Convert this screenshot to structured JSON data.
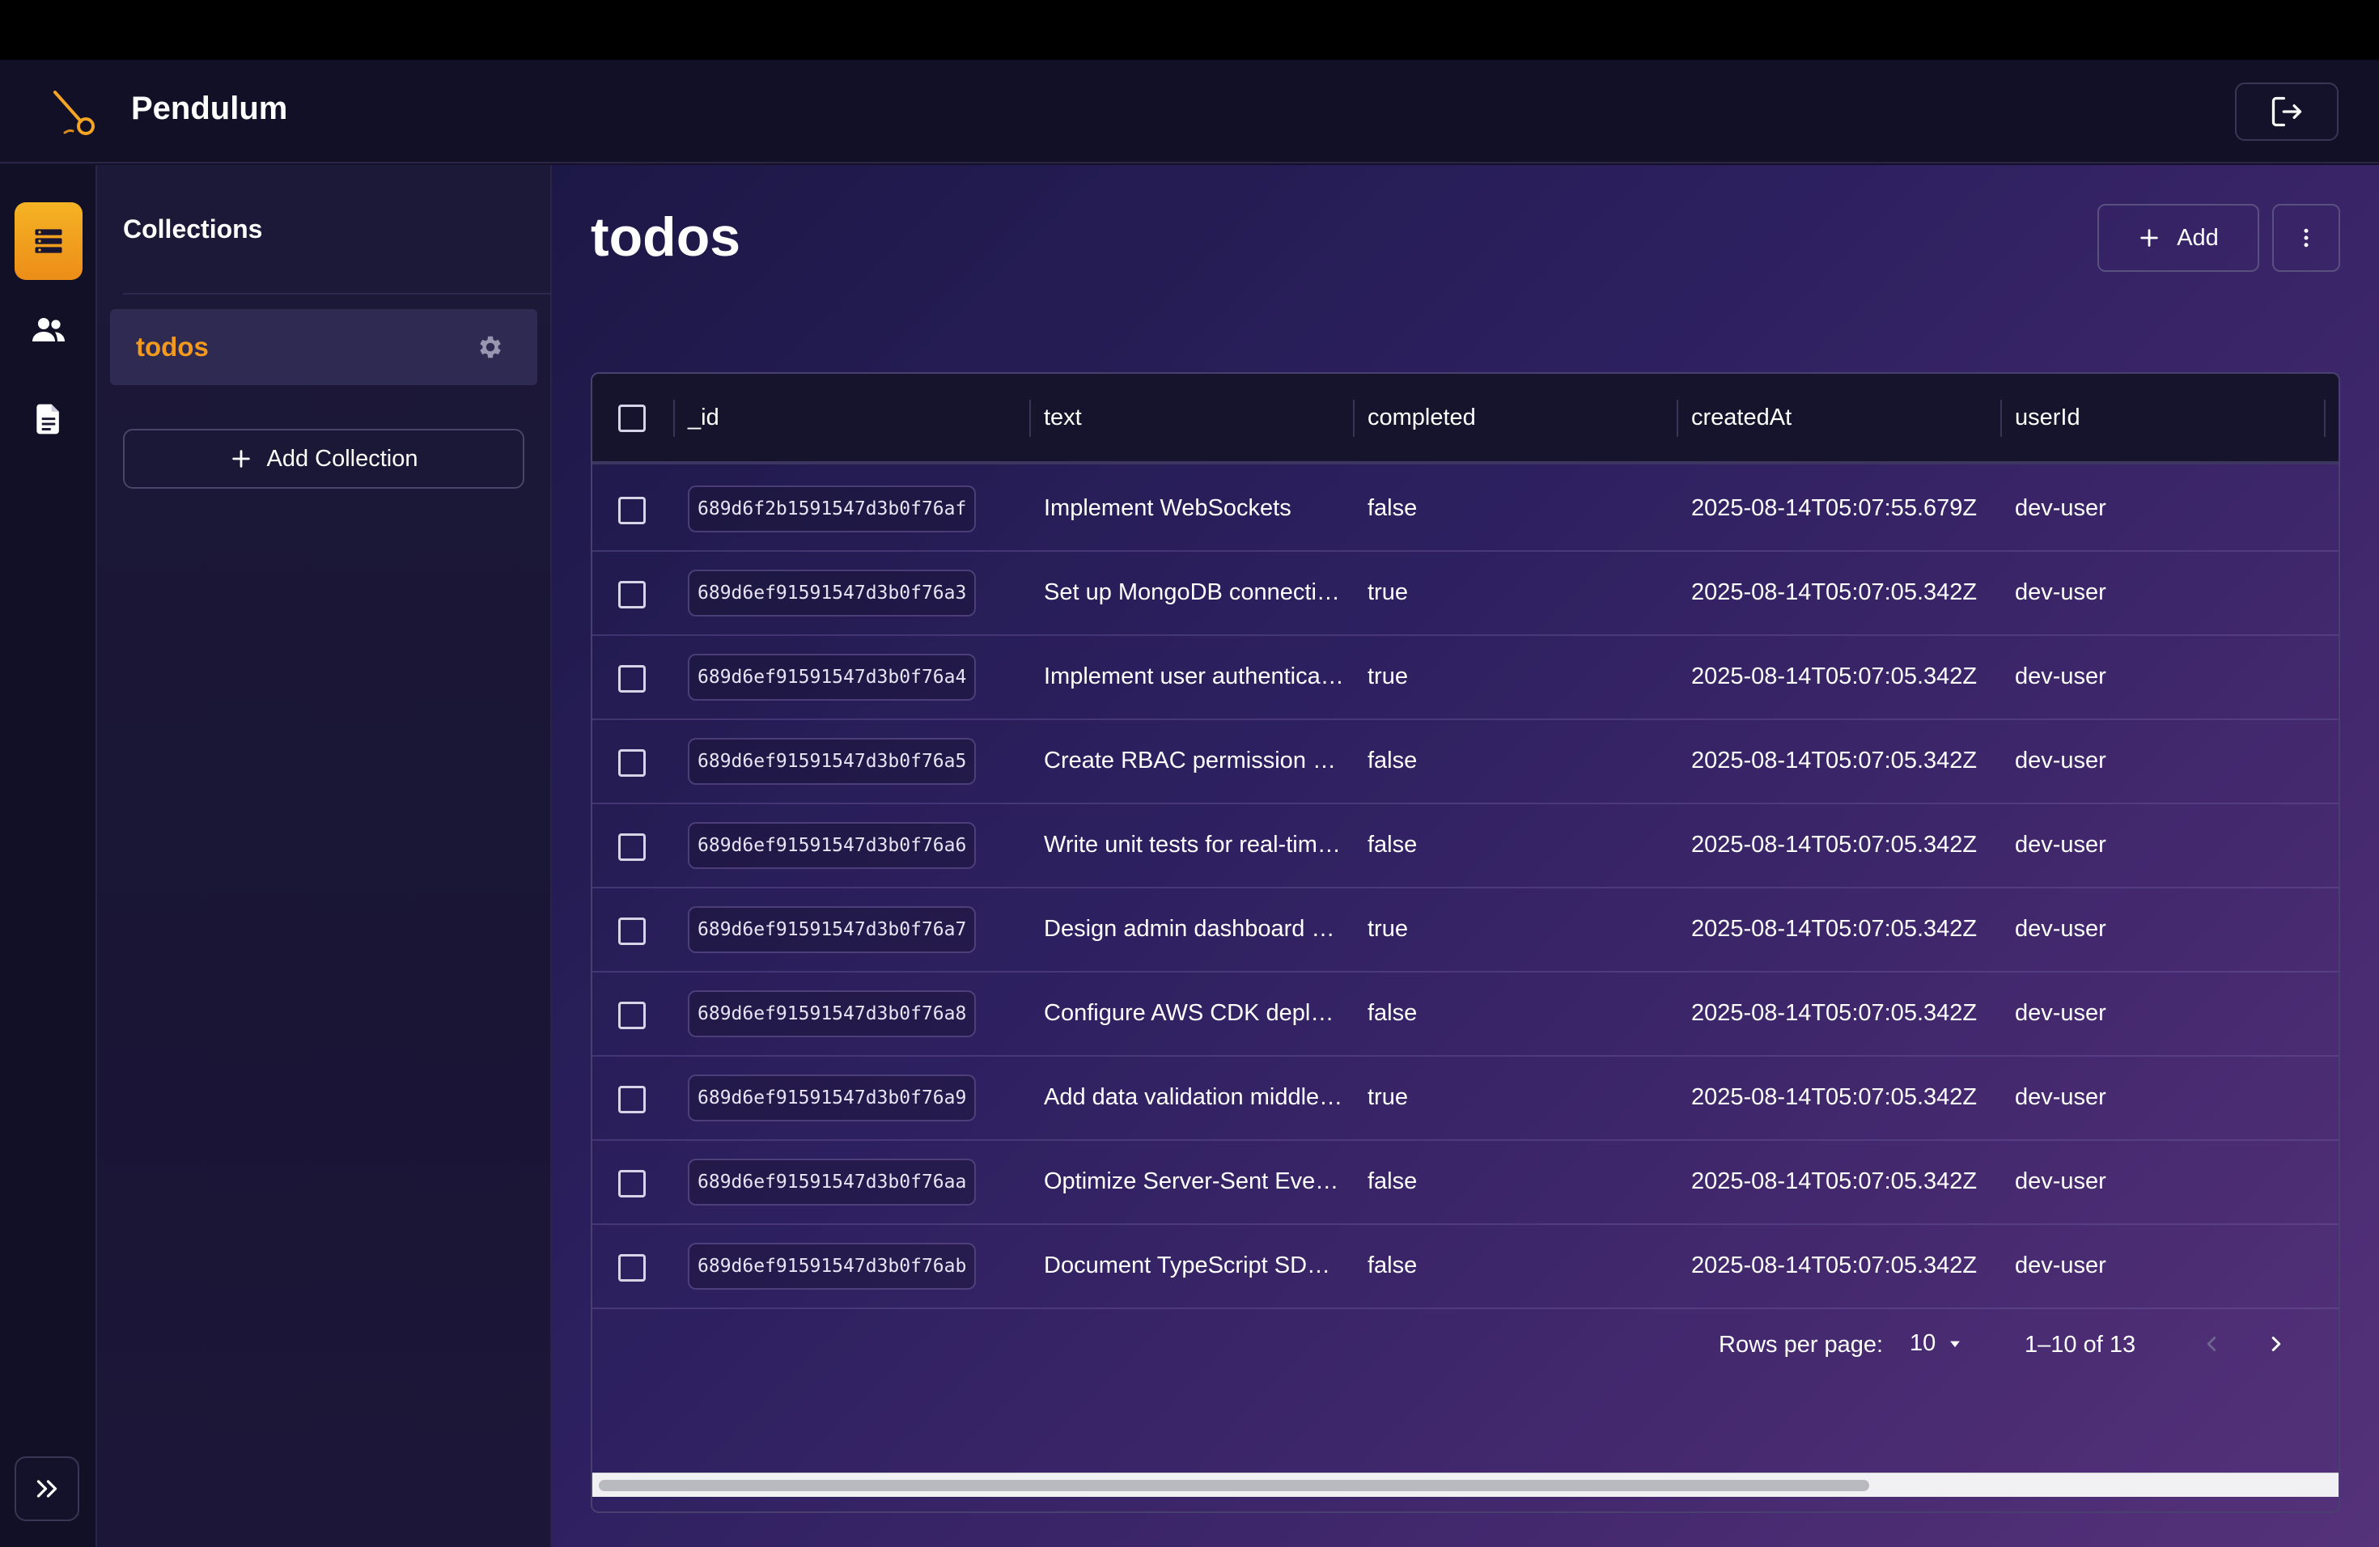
{
  "app": {
    "brand": "Pendulum"
  },
  "sidebar": {
    "title": "Collections",
    "collections": [
      {
        "label": "todos"
      }
    ],
    "add_collection_label": "Add Collection",
    "rail_icons": [
      "collections-icon",
      "users-icon",
      "document-icon"
    ]
  },
  "main": {
    "title": "todos",
    "add_label": "Add"
  },
  "table": {
    "columns": [
      "_id",
      "text",
      "completed",
      "createdAt",
      "userId"
    ],
    "rows": [
      {
        "id": "689d6f2b1591547d3b0f76af",
        "text": "Implement WebSockets",
        "completed": "false",
        "createdAt": "2025-08-14T05:07:55.679Z",
        "userId": "dev-user"
      },
      {
        "id": "689d6ef91591547d3b0f76a3",
        "text": "Set up MongoDB connecti…",
        "completed": "true",
        "createdAt": "2025-08-14T05:07:05.342Z",
        "userId": "dev-user"
      },
      {
        "id": "689d6ef91591547d3b0f76a4",
        "text": "Implement user authentica…",
        "completed": "true",
        "createdAt": "2025-08-14T05:07:05.342Z",
        "userId": "dev-user"
      },
      {
        "id": "689d6ef91591547d3b0f76a5",
        "text": "Create RBAC permission …",
        "completed": "false",
        "createdAt": "2025-08-14T05:07:05.342Z",
        "userId": "dev-user"
      },
      {
        "id": "689d6ef91591547d3b0f76a6",
        "text": "Write unit tests for real-tim…",
        "completed": "false",
        "createdAt": "2025-08-14T05:07:05.342Z",
        "userId": "dev-user"
      },
      {
        "id": "689d6ef91591547d3b0f76a7",
        "text": "Design admin dashboard …",
        "completed": "true",
        "createdAt": "2025-08-14T05:07:05.342Z",
        "userId": "dev-user"
      },
      {
        "id": "689d6ef91591547d3b0f76a8",
        "text": "Configure AWS CDK depl…",
        "completed": "false",
        "createdAt": "2025-08-14T05:07:05.342Z",
        "userId": "dev-user"
      },
      {
        "id": "689d6ef91591547d3b0f76a9",
        "text": "Add data validation middle…",
        "completed": "true",
        "createdAt": "2025-08-14T05:07:05.342Z",
        "userId": "dev-user"
      },
      {
        "id": "689d6ef91591547d3b0f76aa",
        "text": "Optimize Server-Sent Eve…",
        "completed": "false",
        "createdAt": "2025-08-14T05:07:05.342Z",
        "userId": "dev-user"
      },
      {
        "id": "689d6ef91591547d3b0f76ab",
        "text": "Document TypeScript SD…",
        "completed": "false",
        "createdAt": "2025-08-14T05:07:05.342Z",
        "userId": "dev-user"
      }
    ]
  },
  "pagination": {
    "rows_per_page_label": "Rows per page:",
    "rows_per_page_value": "10",
    "range_text": "1–10 of 13"
  },
  "colors": {
    "accent": "#f29a1e",
    "rail_active_top": "#f5b324",
    "rail_active_bottom": "#ec8d18"
  }
}
